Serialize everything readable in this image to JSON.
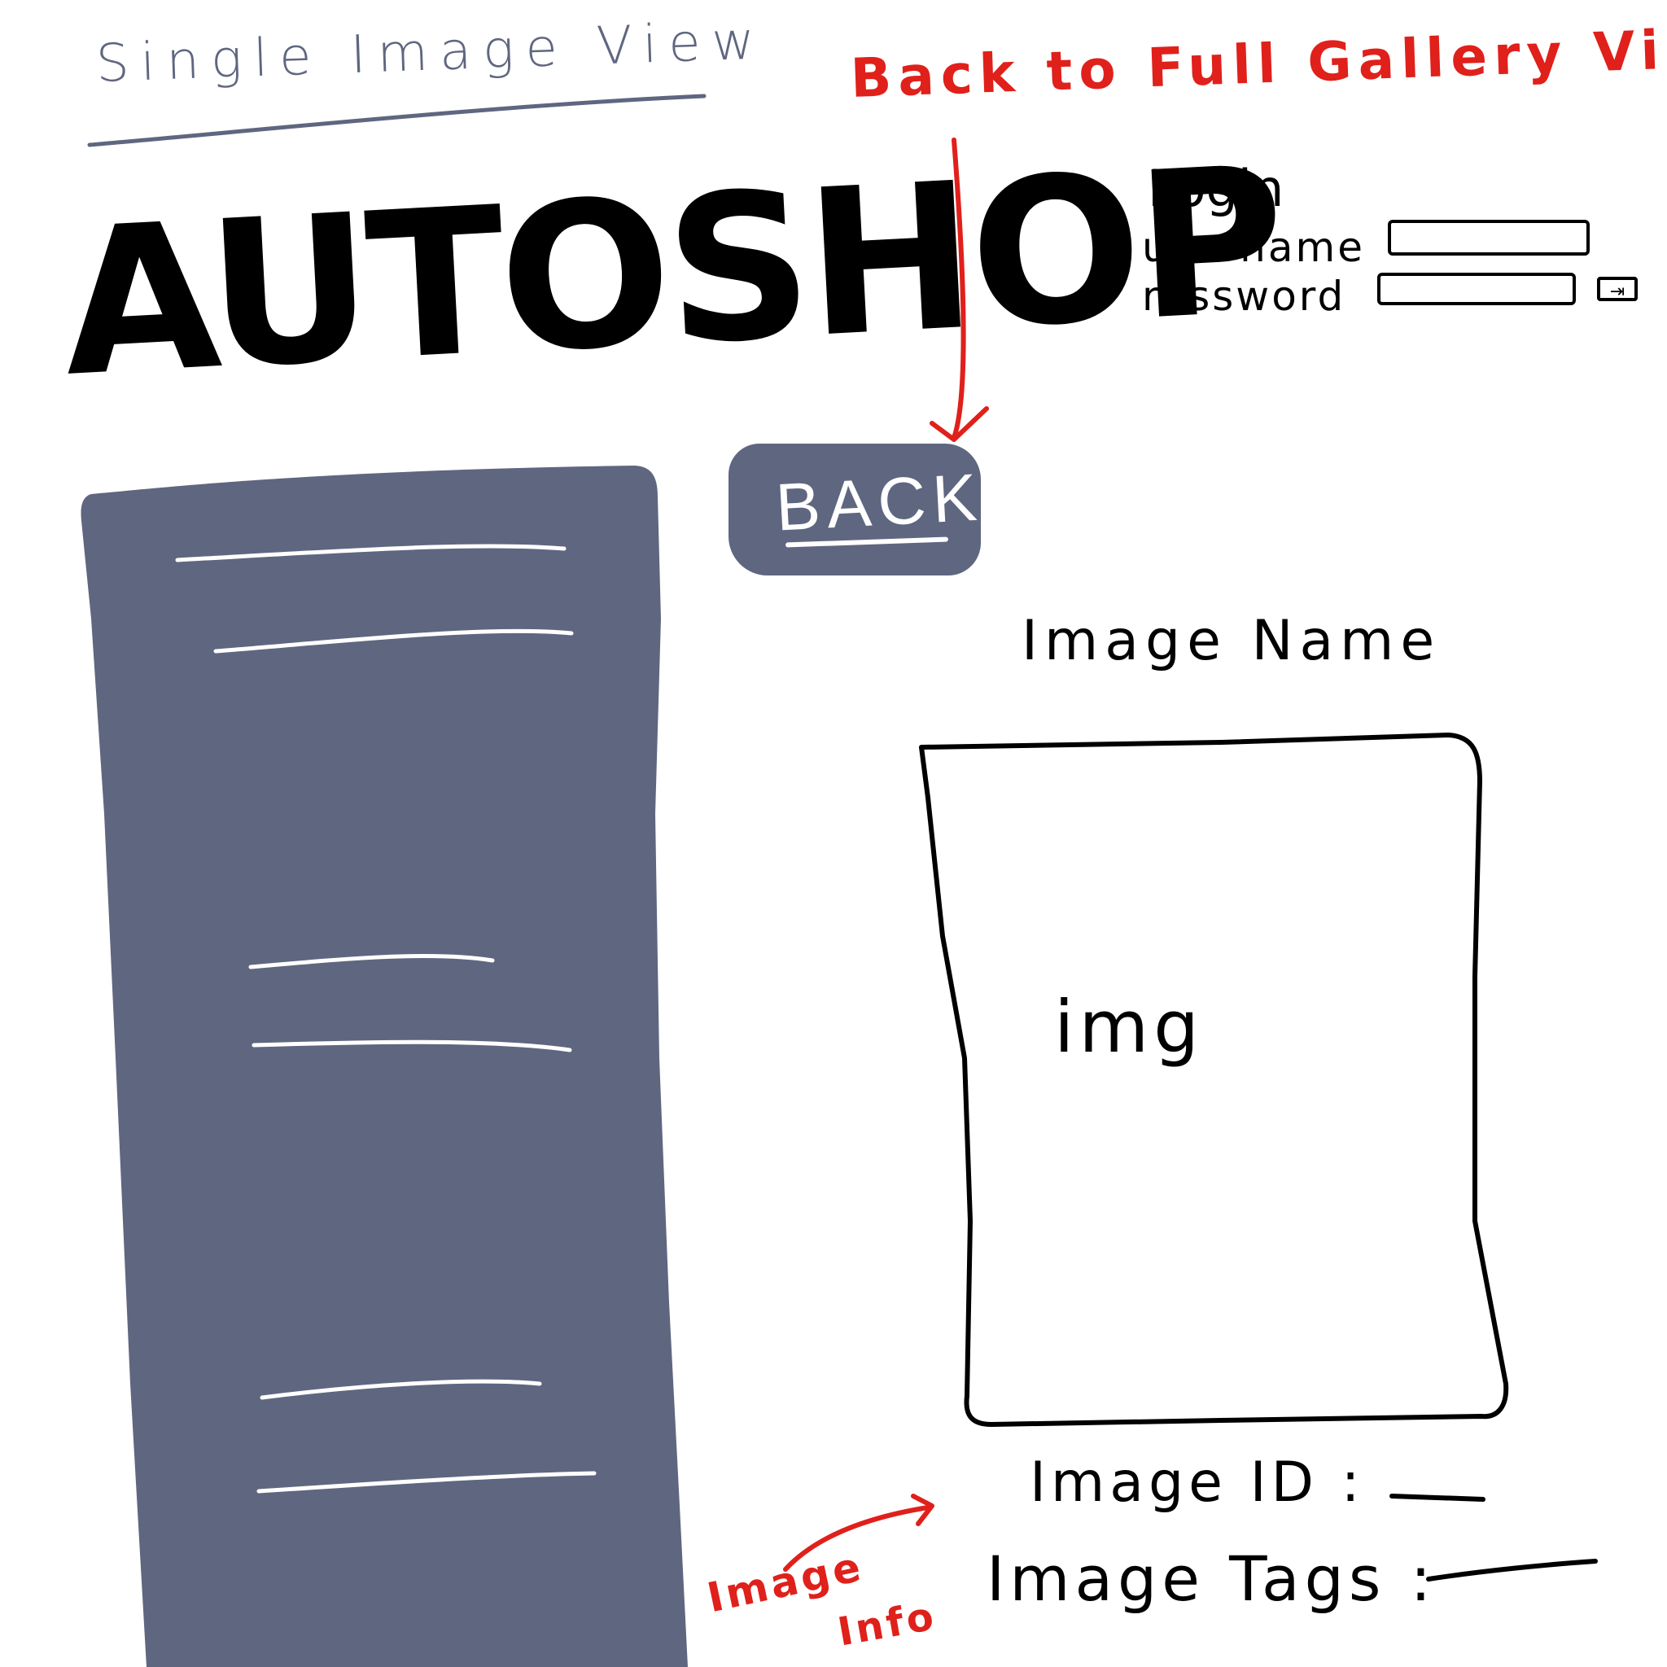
{
  "page": {
    "title": "Single Image View"
  },
  "annotations": {
    "back": "Back to Full Gallery View",
    "image_info_line1": "Image",
    "image_info_line2": "Info"
  },
  "header": {
    "logo": "AUTOSHOP"
  },
  "login": {
    "title": "Login",
    "username_label": "username",
    "password_label": "rassword",
    "submit_icon": "login-arrow-icon"
  },
  "nav": {
    "back_label": "BACK"
  },
  "image": {
    "name": "Image Name",
    "placeholder": "img",
    "id_label": "Image ID :",
    "tags_label": "Image Tags :"
  },
  "colors": {
    "accent": "#5f6680",
    "annotation": "#e0201b",
    "ink": "#000000",
    "background": "#ffffff"
  }
}
